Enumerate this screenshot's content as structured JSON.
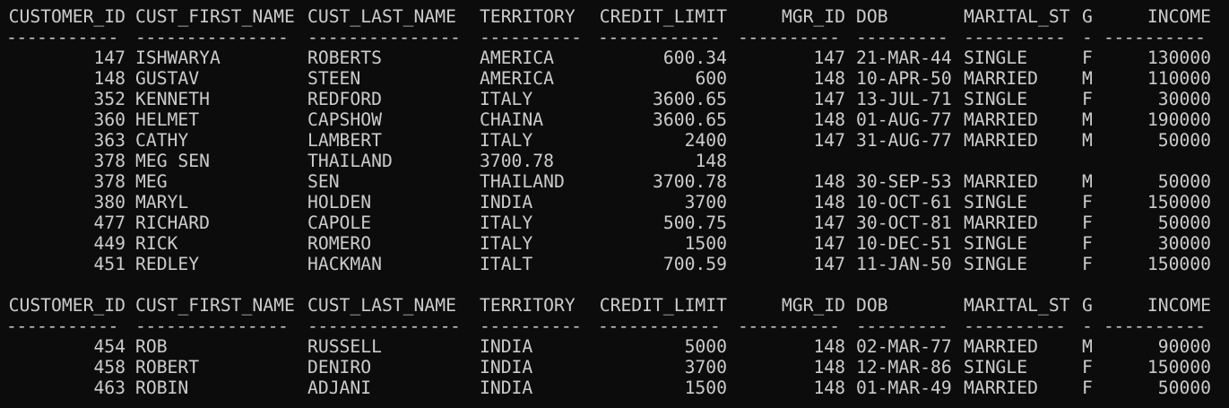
{
  "columns": [
    {
      "key": "customer_id",
      "header": "CUSTOMER_ID",
      "separator": "-----------",
      "align": "right"
    },
    {
      "key": "cust_first_name",
      "header": "CUST_FIRST_NAME",
      "separator": "---------------",
      "align": "left"
    },
    {
      "key": "cust_last_name",
      "header": "CUST_LAST_NAME",
      "separator": "---------------",
      "align": "left"
    },
    {
      "key": "territory",
      "header": "TERRITORY",
      "separator": "----------",
      "align": "left"
    },
    {
      "key": "credit_limit",
      "header": "CREDIT_LIMIT",
      "separator": "------------",
      "align": "right"
    },
    {
      "key": "mgr_id",
      "header": "MGR_ID",
      "separator": "----------",
      "align": "right"
    },
    {
      "key": "dob",
      "header": "DOB",
      "separator": "---------",
      "align": "left"
    },
    {
      "key": "marital_status",
      "header": "MARITAL_ST",
      "separator": "----------",
      "align": "left"
    },
    {
      "key": "gender",
      "header": "G",
      "separator": "-",
      "align": "left"
    },
    {
      "key": "income",
      "header": "INCOME",
      "separator": "----------",
      "align": "right"
    }
  ],
  "blocks": [
    {
      "rows": [
        {
          "customer_id": "147",
          "cust_first_name": "ISHWARYA",
          "cust_last_name": "ROBERTS",
          "territory": "AMERICA",
          "credit_limit": "600.34",
          "mgr_id": "147",
          "dob": "21-MAR-44",
          "marital_status": "SINGLE",
          "gender": "F",
          "income": "130000"
        },
        {
          "customer_id": "148",
          "cust_first_name": "GUSTAV",
          "cust_last_name": "STEEN",
          "territory": "AMERICA",
          "credit_limit": "600",
          "mgr_id": "148",
          "dob": "10-APR-50",
          "marital_status": "MARRIED",
          "gender": "M",
          "income": "110000"
        },
        {
          "customer_id": "352",
          "cust_first_name": "KENNETH",
          "cust_last_name": "REDFORD",
          "territory": "ITALY",
          "credit_limit": "3600.65",
          "mgr_id": "147",
          "dob": "13-JUL-71",
          "marital_status": "SINGLE",
          "gender": "F",
          "income": "30000"
        },
        {
          "customer_id": "360",
          "cust_first_name": "HELMET",
          "cust_last_name": "CAPSHOW",
          "territory": "CHAINA",
          "credit_limit": "3600.65",
          "mgr_id": "148",
          "dob": "01-AUG-77",
          "marital_status": "MARRIED",
          "gender": "M",
          "income": "190000"
        },
        {
          "customer_id": "363",
          "cust_first_name": "CATHY",
          "cust_last_name": "LAMBERT",
          "territory": "ITALY",
          "credit_limit": "2400",
          "mgr_id": "147",
          "dob": "31-AUG-77",
          "marital_status": "MARRIED",
          "gender": "M",
          "income": "50000"
        },
        {
          "customer_id": "378",
          "cust_first_name": "MEG SEN",
          "cust_last_name": "THAILAND",
          "territory": "3700.78",
          "credit_limit": "148",
          "mgr_id": "",
          "dob": "",
          "marital_status": "",
          "gender": "",
          "income": ""
        },
        {
          "customer_id": "378",
          "cust_first_name": "MEG",
          "cust_last_name": "SEN",
          "territory": "THAILAND",
          "credit_limit": "3700.78",
          "mgr_id": "148",
          "dob": "30-SEP-53",
          "marital_status": "MARRIED",
          "gender": "M",
          "income": "50000"
        },
        {
          "customer_id": "380",
          "cust_first_name": "MARYL",
          "cust_last_name": "HOLDEN",
          "territory": "INDIA",
          "credit_limit": "3700",
          "mgr_id": "148",
          "dob": "10-OCT-61",
          "marital_status": "SINGLE",
          "gender": "F",
          "income": "150000"
        },
        {
          "customer_id": "477",
          "cust_first_name": "RICHARD",
          "cust_last_name": "CAPOLE",
          "territory": "ITALY",
          "credit_limit": "500.75",
          "mgr_id": "147",
          "dob": "30-OCT-81",
          "marital_status": "MARRIED",
          "gender": "F",
          "income": "50000"
        },
        {
          "customer_id": "449",
          "cust_first_name": "RICK",
          "cust_last_name": "ROMERO",
          "territory": "ITALY",
          "credit_limit": "1500",
          "mgr_id": "147",
          "dob": "10-DEC-51",
          "marital_status": "SINGLE",
          "gender": "F",
          "income": "30000"
        },
        {
          "customer_id": "451",
          "cust_first_name": "REDLEY",
          "cust_last_name": "HACKMAN",
          "territory": "ITALT",
          "credit_limit": "700.59",
          "mgr_id": "147",
          "dob": "11-JAN-50",
          "marital_status": "SINGLE",
          "gender": "F",
          "income": "150000"
        }
      ]
    },
    {
      "rows": [
        {
          "customer_id": "454",
          "cust_first_name": "ROB",
          "cust_last_name": "RUSSELL",
          "territory": "INDIA",
          "credit_limit": "5000",
          "mgr_id": "148",
          "dob": "02-MAR-77",
          "marital_status": "MARRIED",
          "gender": "M",
          "income": "90000"
        },
        {
          "customer_id": "458",
          "cust_first_name": "ROBERT",
          "cust_last_name": "DENIRO",
          "territory": "INDIA",
          "credit_limit": "3700",
          "mgr_id": "148",
          "dob": "12-MAR-86",
          "marital_status": "SINGLE",
          "gender": "F",
          "income": "150000"
        },
        {
          "customer_id": "463",
          "cust_first_name": "ROBIN",
          "cust_last_name": "ADJANI",
          "territory": "INDIA",
          "credit_limit": "1500",
          "mgr_id": "148",
          "dob": "01-MAR-49",
          "marital_status": "MARRIED",
          "gender": "F",
          "income": "50000"
        }
      ]
    }
  ],
  "colors": {
    "background": "#0c0c0c",
    "foreground": "#cccccc"
  }
}
